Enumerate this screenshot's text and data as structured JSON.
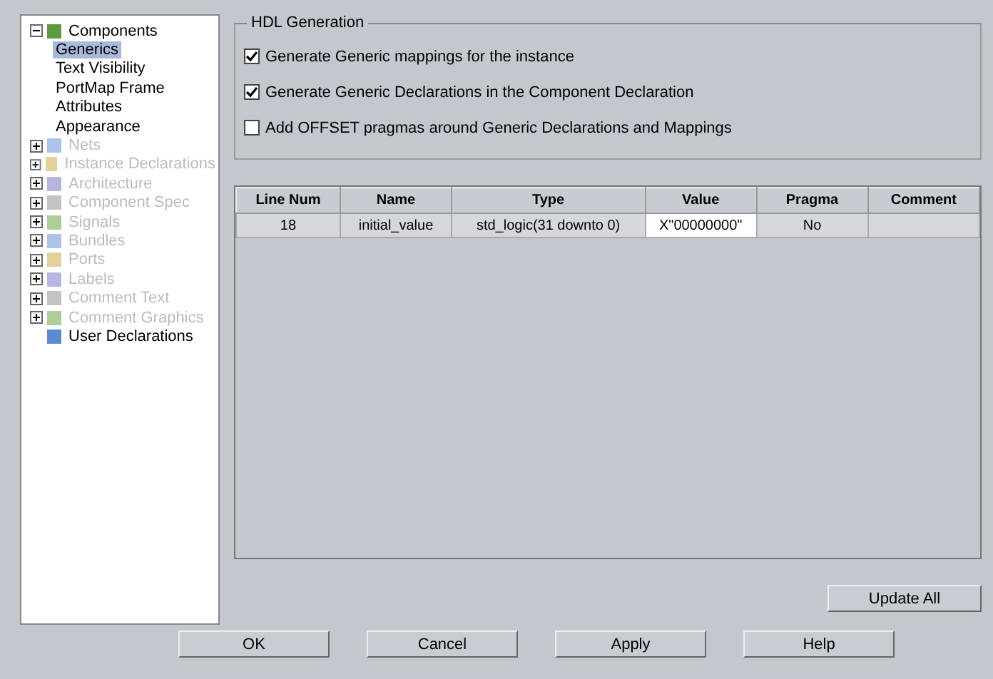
{
  "tree": [
    {
      "label": "Components",
      "expanded": true,
      "greyed": false,
      "selected": false,
      "children": [
        {
          "label": "Generics",
          "selected": true,
          "greyed": false
        },
        {
          "label": "Text Visibility",
          "selected": false,
          "greyed": false
        },
        {
          "label": "PortMap Frame",
          "selected": false,
          "greyed": false
        },
        {
          "label": "Attributes",
          "selected": false,
          "greyed": false
        },
        {
          "label": "Appearance",
          "selected": false,
          "greyed": false
        }
      ]
    },
    {
      "label": "Nets",
      "expanded": false,
      "greyed": true,
      "selected": false
    },
    {
      "label": "Instance Declarations",
      "expanded": false,
      "greyed": true,
      "selected": false
    },
    {
      "label": "Architecture",
      "expanded": false,
      "greyed": true,
      "selected": false
    },
    {
      "label": "Component Spec",
      "expanded": false,
      "greyed": true,
      "selected": false
    },
    {
      "label": "Signals",
      "expanded": false,
      "greyed": true,
      "selected": false
    },
    {
      "label": "Bundles",
      "expanded": false,
      "greyed": true,
      "selected": false
    },
    {
      "label": "Ports",
      "expanded": false,
      "greyed": true,
      "selected": false
    },
    {
      "label": "Labels",
      "expanded": false,
      "greyed": true,
      "selected": false
    },
    {
      "label": "Comment Text",
      "expanded": false,
      "greyed": true,
      "selected": false
    },
    {
      "label": "Comment Graphics",
      "expanded": false,
      "greyed": true,
      "selected": false
    },
    {
      "label": "User Declarations",
      "greyed": false,
      "selected": false
    }
  ],
  "group_title": "HDL Generation",
  "options": [
    {
      "label": "Generate Generic mappings for the instance",
      "checked": true
    },
    {
      "label": "Generate Generic Declarations in the Component Declaration",
      "checked": true
    },
    {
      "label": "Add OFFSET pragmas around Generic Declarations and Mappings",
      "checked": false
    }
  ],
  "table": {
    "columns": [
      "Line Num",
      "Name",
      "Type",
      "Value",
      "Pragma",
      "Comment"
    ],
    "rows": [
      {
        "cells": [
          "18",
          "initial_value",
          "std_logic(31 downto 0)",
          "X\"00000000\"",
          "No"
        ]
      }
    ]
  },
  "update_button": "Update All",
  "buttons": [
    "OK",
    "Cancel",
    "Apply",
    "Help"
  ]
}
